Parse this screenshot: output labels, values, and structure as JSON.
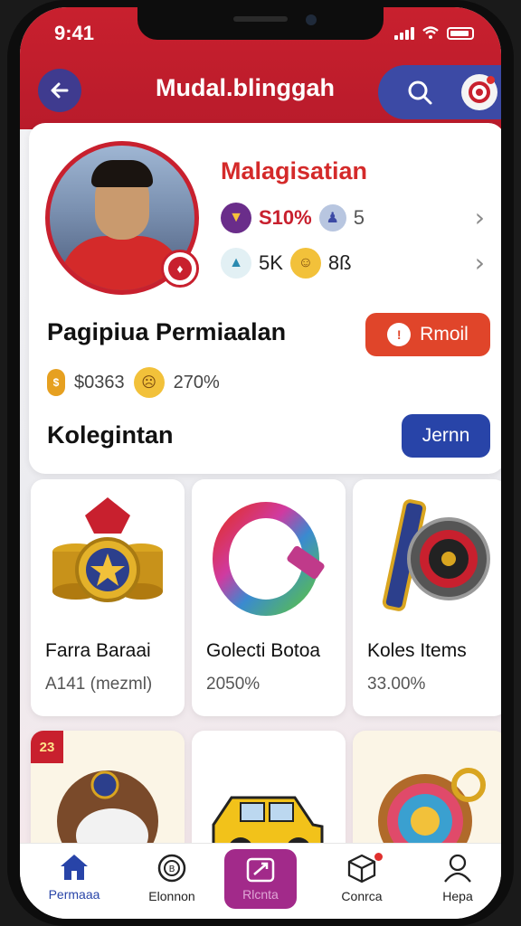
{
  "status": {
    "time": "9:41"
  },
  "header": {
    "title": "Mudal.blinggah",
    "back_icon": "arrow-left-icon",
    "search_icon": "search-icon",
    "notification_icon": "target-icon"
  },
  "profile": {
    "name": "Malagisatian",
    "stat1_value": "S10%",
    "stat1_extra": "5",
    "stat2_value": "5K",
    "stat2_extra": "8ß",
    "badge_icon": "fire-icon"
  },
  "section1": {
    "title": "Pagipiua Permiaalan",
    "button_label": "Rmoil",
    "coins": "$0363",
    "percent": "270%"
  },
  "section2": {
    "title": "Kolegintan",
    "button_label": "Jernn"
  },
  "items": [
    {
      "title": "Farra Baraai",
      "subtitle": "A141 (mezml)"
    },
    {
      "title": "Golecti Botoa",
      "subtitle": "2050%"
    },
    {
      "title": "Koles Items",
      "subtitle": "33.00%"
    }
  ],
  "items_row2": [
    {
      "badge": "23",
      "icon": "ball-icon"
    },
    {
      "icon": "car-icon"
    },
    {
      "icon": "roulette-icon"
    }
  ],
  "nav": [
    {
      "label": "Permaaa",
      "icon": "home-icon"
    },
    {
      "label": "Elonnon",
      "icon": "coin-icon"
    },
    {
      "label": "Rlcnta",
      "icon": "store-icon"
    },
    {
      "label": "Conrca",
      "icon": "box-icon"
    },
    {
      "label": "Hepa",
      "icon": "user-icon"
    }
  ],
  "colors": {
    "brand_red": "#c8202e",
    "brand_blue": "#2844a8",
    "button_orange": "#e0452a",
    "nav_active": "#a22a8a"
  }
}
